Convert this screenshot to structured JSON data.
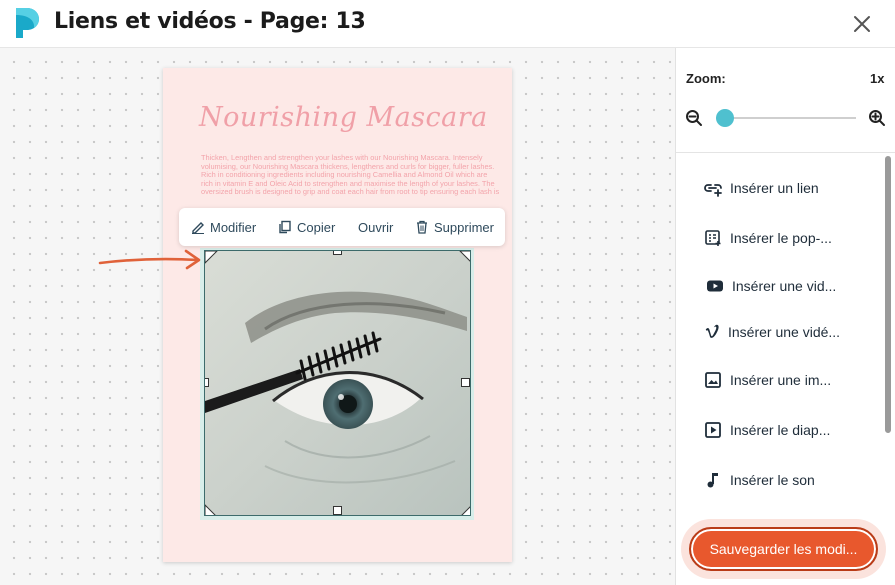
{
  "header": {
    "title": "Liens et vidéos - Page: 13"
  },
  "page": {
    "title": "Nourishing Mascara",
    "body": "Thicken, Lengthen and strengthen your lashes with our Nourishing Mascara. Intensely volumising, our Nourishing Mascara thickens, lengthens and curls for bigger, fuller lashes. Rich in conditioning ingredients including nourishing Camellia and Almond Oil which are rich in vitamin E and Oleic Acid to strengthen and maximise the length of your lashes. The oversized brush is designed to grip and coat each hair from root to tip ensuring each lash is"
  },
  "toolbar": {
    "edit": "Modifier",
    "copy": "Copier",
    "open": "Ouvrir",
    "delete": "Supprimer"
  },
  "zoom": {
    "label": "Zoom:",
    "value": "1x",
    "level": 0
  },
  "menu": [
    {
      "label": "Insérer un lien",
      "icon": "link-add-icon"
    },
    {
      "label": "Insérer le pop-...",
      "icon": "popup-icon"
    },
    {
      "label": "Insérer une vid...",
      "icon": "youtube-icon"
    },
    {
      "label": "Insérer une vidé...",
      "icon": "vimeo-icon"
    },
    {
      "label": "Insérer une im...",
      "icon": "image-icon"
    },
    {
      "label": "Insérer le diap...",
      "icon": "slideshow-icon"
    },
    {
      "label": "Insérer le son",
      "icon": "music-note-icon"
    }
  ],
  "save_button": "Sauvegarder les modi...",
  "colors": {
    "accent": "#e8582d",
    "slider": "#4fc0cf",
    "page_bg": "#fde9e7",
    "page_text": "#f0a0a8"
  }
}
